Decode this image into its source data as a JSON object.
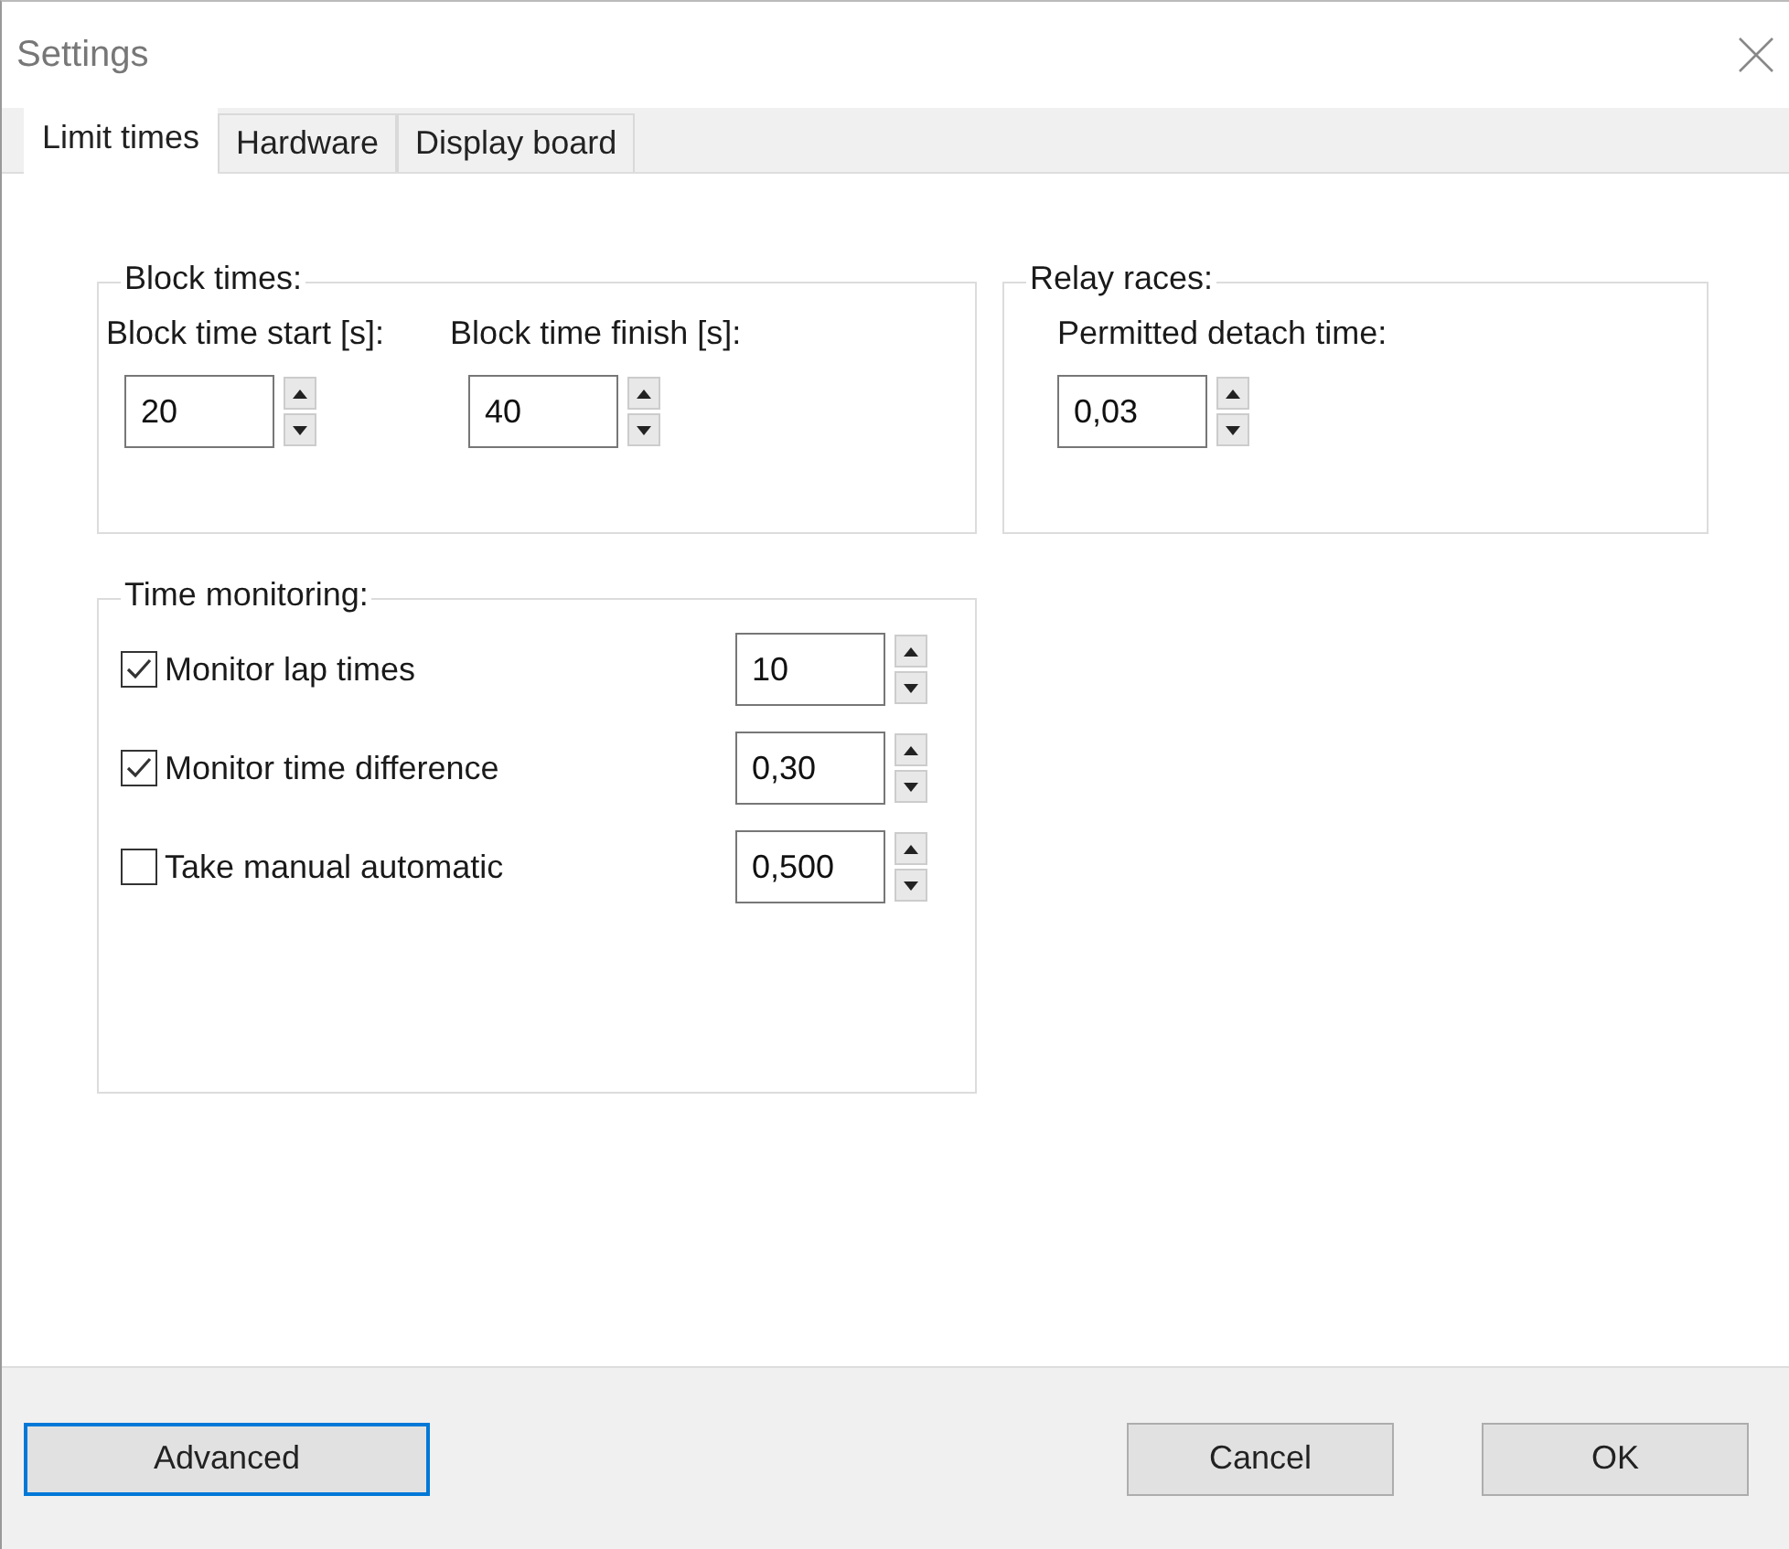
{
  "window": {
    "title": "Settings"
  },
  "tabs": [
    {
      "label": "Limit times",
      "selected": true
    },
    {
      "label": "Hardware",
      "selected": false
    },
    {
      "label": "Display board",
      "selected": false
    }
  ],
  "block_times": {
    "title": "Block times:",
    "fields": [
      {
        "label": "Block time start [s]:",
        "value": "20"
      },
      {
        "label": "Block time finish [s]:",
        "value": "40"
      }
    ]
  },
  "relay_races": {
    "title": "Relay races:",
    "fields": [
      {
        "label": "Permitted detach time:",
        "value": "0,03"
      }
    ]
  },
  "time_monitoring": {
    "title": "Time monitoring:",
    "items": [
      {
        "label": "Monitor lap times",
        "checked": true,
        "value": "10"
      },
      {
        "label": "Monitor time difference",
        "checked": true,
        "value": "0,30"
      },
      {
        "label": "Take manual automatic",
        "checked": false,
        "value": "0,500"
      }
    ]
  },
  "footer": {
    "left_buttons": [
      {
        "label": "Advanced",
        "focused": true
      }
    ],
    "right_buttons": [
      {
        "label": "Cancel",
        "focused": false
      },
      {
        "label": "OK",
        "focused": false
      }
    ]
  }
}
